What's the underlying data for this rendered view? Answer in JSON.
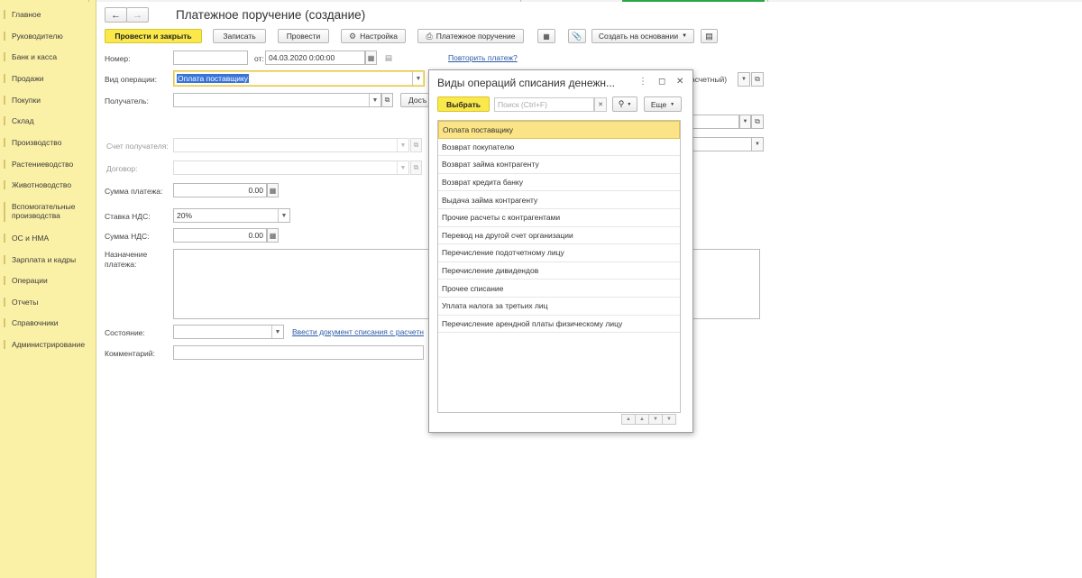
{
  "sidebar": {
    "items": [
      {
        "label": "Главное"
      },
      {
        "label": "Руководителю"
      },
      {
        "label": "Банк и касса"
      },
      {
        "label": "Продажи"
      },
      {
        "label": "Покупки"
      },
      {
        "label": "Склад"
      },
      {
        "label": "Производство"
      },
      {
        "label": "Растениеводство"
      },
      {
        "label": "Животноводство"
      },
      {
        "label": "Вспомогательные производства"
      },
      {
        "label": "ОС и НМА"
      },
      {
        "label": "Зарплата и кадры"
      },
      {
        "label": "Операции"
      },
      {
        "label": "Отчеты"
      },
      {
        "label": "Справочники"
      },
      {
        "label": "Администрирование"
      }
    ]
  },
  "form": {
    "title": "Платежное поручение (создание)",
    "toolbar": {
      "post_close": "Провести и закрыть",
      "save": "Записать",
      "post": "Провести",
      "settings": "Настройка",
      "print": "Платежное поручение",
      "create_based": "Создать на основании"
    },
    "number_label": "Номер:",
    "number_value": "",
    "date_label": "от:",
    "date_value": "04.03.2020  0:00:00",
    "repeat_link": "Повторить платеж?",
    "operation_label": "Вид операции:",
    "operation_value": "Оплата поставщику",
    "recipient_label": "Получатель:",
    "recipient_value": "",
    "doc_button_partial": "Досъ",
    "right_partial_text": "асчетный)",
    "recipient_account_label": "Счет получателя:",
    "contract_label": "Договор:",
    "payment_sum_label": "Сумма платежа:",
    "payment_sum_value": "0.00",
    "vat_rate_label": "Ставка НДС:",
    "vat_rate_value": "20%",
    "vat_sum_label": "Сумма НДС:",
    "vat_sum_value": "0.00",
    "purpose_label": "Назначение платежа:",
    "status_label": "Состояние:",
    "status_value": "",
    "enter_doc_link": "Ввести документ списания с расчетн",
    "comment_label": "Комментарий:",
    "comment_value": ""
  },
  "dialog": {
    "title": "Виды операций списания денежн...",
    "select_button": "Выбрать",
    "search_placeholder": "Поиск (Ctrl+F)",
    "more_button": "Еще",
    "items": [
      {
        "label": "Оплата поставщику",
        "selected": true
      },
      {
        "label": "Возврат покупателю"
      },
      {
        "label": "Возврат займа контрагенту"
      },
      {
        "label": "Возврат кредита банку"
      },
      {
        "label": "Выдача займа контрагенту"
      },
      {
        "label": "Прочие расчеты с контрагентами"
      },
      {
        "label": "Перевод на другой счет организации"
      },
      {
        "label": "Перечисление подотчетному лицу"
      },
      {
        "label": "Перечисление дивидендов"
      },
      {
        "label": "Прочее списание"
      },
      {
        "label": "Уплата налога за третьих лиц"
      },
      {
        "label": "Перечисление арендной платы физическому лицу"
      }
    ]
  },
  "colors": {
    "sidebar_bg": "#fbf1a6",
    "primary_button": "#fbe94b",
    "selected_row": "#fbe487",
    "link": "#2b5aa6",
    "accent_green": "#28a745"
  }
}
